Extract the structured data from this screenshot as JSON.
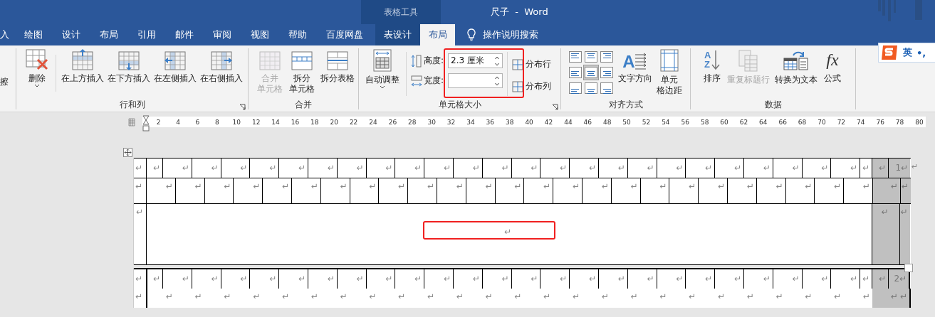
{
  "title_bar": {
    "contextual_group": "表格工具",
    "title": "尺子  -  Word"
  },
  "tabs": [
    {
      "label": "入",
      "selected": false,
      "contextual": false
    },
    {
      "label": "绘图",
      "selected": false,
      "contextual": false
    },
    {
      "label": "设计",
      "selected": false,
      "contextual": false
    },
    {
      "label": "布局",
      "selected": false,
      "contextual": false
    },
    {
      "label": "引用",
      "selected": false,
      "contextual": false
    },
    {
      "label": "邮件",
      "selected": false,
      "contextual": false
    },
    {
      "label": "审阅",
      "selected": false,
      "contextual": false
    },
    {
      "label": "视图",
      "selected": false,
      "contextual": false
    },
    {
      "label": "帮助",
      "selected": false,
      "contextual": false
    },
    {
      "label": "百度网盘",
      "selected": false,
      "contextual": false
    },
    {
      "label": "表设计",
      "selected": false,
      "contextual": true
    },
    {
      "label": "布局",
      "selected": true,
      "contextual": true
    }
  ],
  "tell_me": {
    "label": "操作说明搜索"
  },
  "ribbon": {
    "clipped_button": {
      "label": "擦"
    },
    "rows_columns": {
      "title": "行和列",
      "delete": {
        "label": "删除"
      },
      "insert_buttons": [
        {
          "label": "在上方插入"
        },
        {
          "label": "在下方插入"
        },
        {
          "label": "在左侧插入"
        },
        {
          "label": "在右侧插入"
        }
      ]
    },
    "merge": {
      "title": "合并",
      "buttons": [
        {
          "lines": [
            "合并",
            "单元格"
          ],
          "disabled": true
        },
        {
          "lines": [
            "拆分",
            "单元格"
          ],
          "disabled": false
        },
        {
          "lines": [
            "拆分表格"
          ],
          "disabled": false
        }
      ]
    },
    "cell_size": {
      "title": "单元格大小",
      "autofit": {
        "label": "自动调整"
      },
      "height": {
        "label": "高度:",
        "value": "2.3 厘米"
      },
      "width": {
        "label": "宽度:"
      },
      "distribute": [
        {
          "label": "分布行"
        },
        {
          "label": "分布列"
        }
      ]
    },
    "alignment": {
      "title": "对齐方式",
      "cells": [
        {
          "selected": false
        },
        {
          "selected": false
        },
        {
          "selected": false
        },
        {
          "selected": false
        },
        {
          "selected": true
        },
        {
          "selected": false
        },
        {
          "selected": false
        },
        {
          "selected": false
        },
        {
          "selected": false
        }
      ],
      "text_direction": {
        "label": "文字方向",
        "icon_letter": "A"
      },
      "margins": {
        "lines": [
          "单元",
          "格边距"
        ]
      }
    },
    "data": {
      "title": "数据",
      "buttons": [
        {
          "label": "排序",
          "disabled": false,
          "icon_text": "A Z"
        },
        {
          "label": "重复标题行",
          "disabled": true
        },
        {
          "label": "转换为文本",
          "disabled": false
        },
        {
          "label": "公式",
          "disabled": false,
          "icon_text": "fx"
        }
      ]
    }
  },
  "ime": {
    "mode": "英",
    "punctuation": "•,"
  },
  "ruler": {
    "numbers": [
      "2",
      "4",
      "6",
      "8",
      "10",
      "12",
      "14",
      "16",
      "18",
      "20",
      "22",
      "24",
      "26",
      "28",
      "30",
      "32",
      "34",
      "36",
      "38",
      "40",
      "42",
      "44",
      "46",
      "48",
      "50",
      "52",
      "54",
      "56",
      "58",
      "60",
      "62",
      "64",
      "66",
      "68",
      "70",
      "72",
      "74",
      "76",
      "78",
      "80"
    ]
  },
  "blocks": [
    {
      "lines": [
        {
          "kind": "narrow_first",
          "marks": [
            "↵",
            "↵",
            "↵",
            "↵",
            "↵",
            "↵",
            "↵",
            "↵",
            "↵",
            "↵",
            "↵",
            "↵",
            "↵",
            "↵",
            "↵",
            "↵",
            "↵",
            "↵",
            "↵",
            "↵",
            "↵",
            "↵",
            "↵",
            "↵",
            "↵",
            "↵",
            "↵"
          ],
          "selected_marks": [
            "↵",
            "1↵"
          ],
          "end_mark": "↵"
        },
        {
          "kind": "wide_first",
          "marks": [
            "↵",
            "↵",
            "↵",
            "↵",
            "↵",
            "↵",
            "↵",
            "↵",
            "↵",
            "↵",
            "↵",
            "↵",
            "↵",
            "↵",
            "↵",
            "↵",
            "↵",
            "↵",
            "↵",
            "↵",
            "↵",
            "↵",
            "↵",
            "↵",
            "↵",
            "↵"
          ],
          "selected_marks": [
            "↵",
            "↵"
          ]
        },
        {
          "kind": "merged",
          "marks": [
            "↵",
            "↵"
          ],
          "selected_marks": [
            "↵",
            "↵"
          ]
        }
      ]
    },
    {
      "lines": [
        {
          "kind": "narrow_first",
          "marks": [
            "↵",
            "↵",
            "↵",
            "↵",
            "↵",
            "↵",
            "↵",
            "↵",
            "↵",
            "↵",
            "↵",
            "↵",
            "↵",
            "↵",
            "↵",
            "↵",
            "↵",
            "↵",
            "↵",
            "↵",
            "↵",
            "↵",
            "↵",
            "↵",
            "↵",
            "↵",
            "↵"
          ],
          "selected_marks": [
            "↵",
            "2↵"
          ]
        },
        {
          "kind": "open",
          "marks": [
            "↵",
            "↵",
            "↵",
            "↵",
            "↵",
            "↵",
            "↵",
            "↵",
            "↵",
            "↵",
            "↵",
            "↵",
            "↵",
            "↵",
            "↵",
            "↵",
            "↵",
            "↵",
            "↵",
            "↵",
            "↵",
            "↵",
            "↵",
            "↵",
            "↵",
            "↵"
          ],
          "selected_marks": [
            "↵",
            "↵"
          ]
        }
      ]
    }
  ]
}
